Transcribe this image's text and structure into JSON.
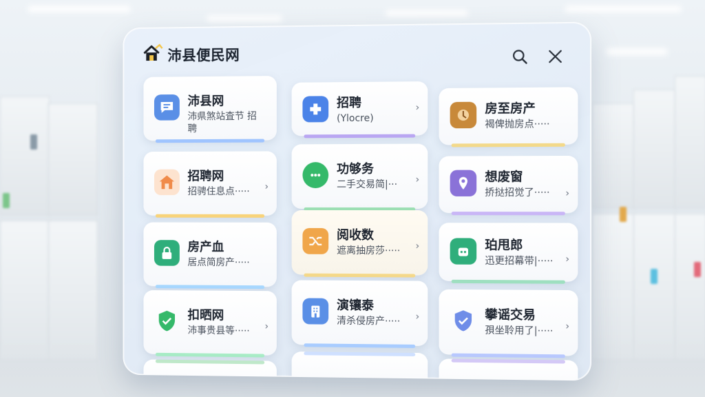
{
  "app": {
    "title": "沛县便民网",
    "icons": {
      "logo": "house-logo-icon",
      "search": "search-icon",
      "close": "close-icon"
    }
  },
  "cards": [
    {
      "title": "沛县网",
      "subtitle": "沛県煞站査节 招聘",
      "chevron": "",
      "icon": "chat-bubble-icon",
      "accent": "#5a8fe6"
    },
    {
      "title": "招聘",
      "subtitle": "(Ylocre)",
      "chevron": "›",
      "icon": "plus-icon",
      "accent": "#4b83e8"
    },
    {
      "title": "房至房产",
      "subtitle": "褐俾抛房点·····",
      "chevron": "",
      "icon": "brown-badge-icon",
      "accent": "#c8893a"
    },
    {
      "title": "招聘网",
      "subtitle": "招骋住息点·····",
      "chevron": "›",
      "icon": "house-icon",
      "accent": "#f08b4a"
    },
    {
      "title": "功够务",
      "subtitle": "二手交易简|···",
      "chevron": "›",
      "icon": "message-icon",
      "accent": "#35b96a"
    },
    {
      "title": "想废窗",
      "subtitle": "挢挞招觉了·····",
      "chevron": "›",
      "icon": "location-pin-icon",
      "accent": "#8a72d8"
    },
    {
      "title": "房产血",
      "subtitle": "居点简房产·····",
      "chevron": "",
      "icon": "lock-icon",
      "accent": "#2fae7b"
    },
    {
      "title": "阅收数",
      "subtitle": "遮离抽房莎·····",
      "chevron": "›",
      "icon": "shuffle-icon",
      "accent": "#f0a64a"
    },
    {
      "title": "珀甩郎",
      "subtitle": "迅更招幕带|·····",
      "chevron": "›",
      "icon": "robot-icon",
      "accent": "#2fae7b"
    },
    {
      "title": "扣晒网",
      "subtitle": "沛事贵县等·····",
      "chevron": "›",
      "icon": "shield-check-icon",
      "accent": "#35b96a"
    },
    {
      "title": "演镶泰",
      "subtitle": "清杀侵房产·····",
      "chevron": "›",
      "icon": "building-icon",
      "accent": "#5a8fe6"
    },
    {
      "title": "攀谣交易",
      "subtitle": "孭坐聆用了|·····",
      "chevron": "›",
      "icon": "shield-check-icon",
      "accent": "#6f8de8"
    }
  ]
}
